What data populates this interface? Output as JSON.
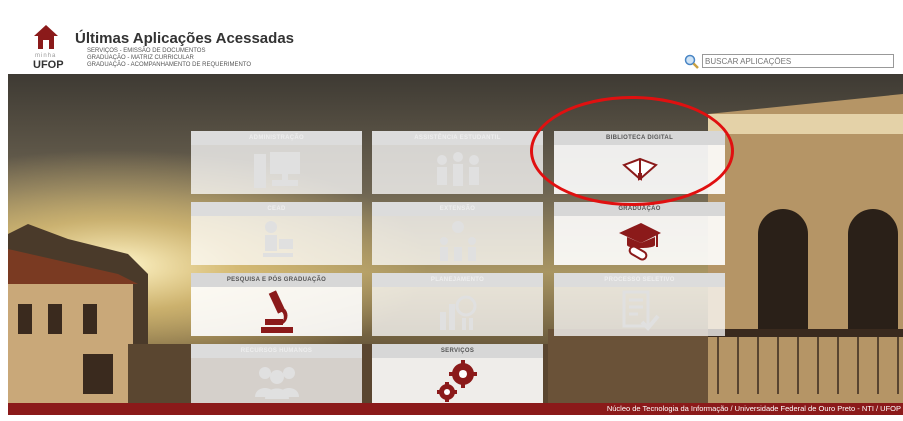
{
  "header": {
    "logo_mini": "minha",
    "logo_text": "UFOP",
    "title": "Últimas Aplicações Acessadas",
    "recent": [
      "SERVIÇOS - EMISSÃO DE DOCUMENTOS",
      "GRADUAÇÃO - MATRIZ CURRICULAR",
      "GRADUAÇÃO - ACOMPANHAMENTO DE REQUERIMENTO"
    ]
  },
  "search": {
    "placeholder": "BUSCAR APLICAÇÕES"
  },
  "tiles": [
    {
      "label": "ADMINISTRAÇÃO",
      "icon": "computer-icon",
      "enabled": false
    },
    {
      "label": "ASSISTÊNCIA ESTUDANTIL",
      "icon": "group-icon",
      "enabled": false
    },
    {
      "label": "BIBLIOTECA DIGITAL",
      "icon": "book-icon",
      "enabled": true
    },
    {
      "label": "CEAD",
      "icon": "student-desk-icon",
      "enabled": false
    },
    {
      "label": "EXTENSÃO",
      "icon": "network-icon",
      "enabled": false
    },
    {
      "label": "GRADUAÇÃO",
      "icon": "graduation-cap-icon",
      "enabled": true
    },
    {
      "label": "PESQUISA E PÓS GRADUAÇÃO",
      "icon": "microscope-icon",
      "enabled": true
    },
    {
      "label": "PLANEJAMENTO",
      "icon": "chart-icon",
      "enabled": false
    },
    {
      "label": "PROCESSO SELETIVO",
      "icon": "checklist-icon",
      "enabled": false
    },
    {
      "label": "RECURSOS HUMANOS",
      "icon": "people-icon",
      "enabled": false
    },
    {
      "label": "SERVIÇOS",
      "icon": "gears-icon",
      "enabled": true
    }
  ],
  "footer": {
    "text": "Núcleo de Tecnologia da Informação / Universidade Federal de Ouro Preto - NTI / UFOP"
  },
  "colors": {
    "accent": "#8b1a1a",
    "highlight": "#e01010"
  }
}
